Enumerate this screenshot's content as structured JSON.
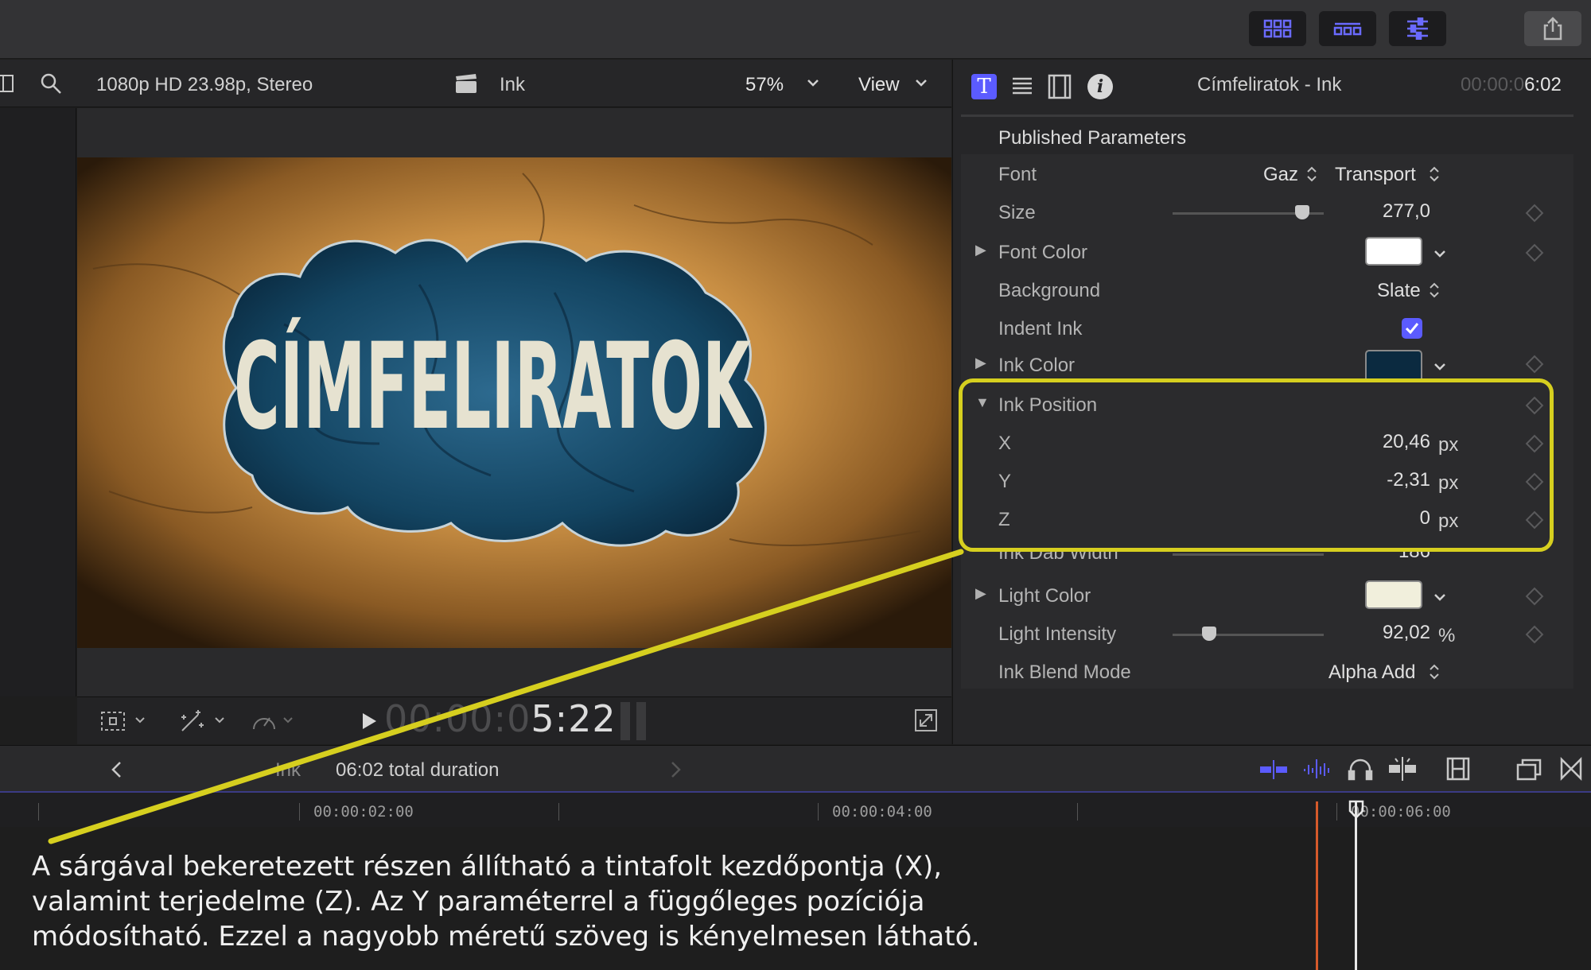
{
  "viewer": {
    "format": "1080p HD 23.98p, Stereo",
    "clip_name": "Ink",
    "zoom": "57%",
    "view_label": "View",
    "title_overlay": "CÍMFELIRATOK",
    "timecode_dim": "00:00:0",
    "timecode_bright": "5:22"
  },
  "inspector": {
    "title": "Címfeliratok - Ink",
    "timecode_dim": "00:00:0",
    "timecode_bright": "6:02",
    "section_title": "Published Parameters",
    "params": {
      "font": {
        "label": "Font",
        "family": "Gaz",
        "style": "Transport"
      },
      "size": {
        "label": "Size",
        "value": "277,0",
        "slider_fraction": 0.86
      },
      "font_color": {
        "label": "Font Color",
        "swatch": "#ffffff"
      },
      "background": {
        "label": "Background",
        "value": "Slate"
      },
      "indent_ink": {
        "label": "Indent Ink",
        "checked": true
      },
      "ink_color": {
        "label": "Ink Color",
        "swatch": "#0b2a40"
      },
      "ink_position": {
        "label": "Ink Position"
      },
      "x": {
        "label": "X",
        "value": "20,46",
        "unit": "px"
      },
      "y": {
        "label": "Y",
        "value": "-2,31",
        "unit": "px"
      },
      "z": {
        "label": "Z",
        "value": "0",
        "unit": "px"
      },
      "ink_dab_width": {
        "label": "Ink Dab Width",
        "value": "186"
      },
      "light_color": {
        "label": "Light Color",
        "swatch": "#f1efdc"
      },
      "light_intensity": {
        "label": "Light Intensity",
        "value": "92,02",
        "unit": "%",
        "slider_fraction": 0.24
      },
      "ink_blend_mode": {
        "label": "Ink Blend Mode",
        "value": "Alpha Add"
      }
    }
  },
  "timeline": {
    "clip_name": "Ink",
    "duration": "06:02 total duration",
    "ticks": [
      "00:00:02:00",
      "00:00:04:00",
      "00:00:06:00"
    ]
  },
  "annotation": {
    "caption_lines": [
      "A sárgával bekeretezett részen állítható a tintafolt kezdőpontja (X),",
      "valamint terjedelme (Z). Az Y paraméterrel a függőleges pozíciója",
      "módosítható. Ezzel a nagyobb méretű szöveg is kényelmesen látható."
    ],
    "highlight_color": "#d6cf1f"
  },
  "colors": {
    "accent": "#5b5bff",
    "playhead": "#d65a2b"
  }
}
